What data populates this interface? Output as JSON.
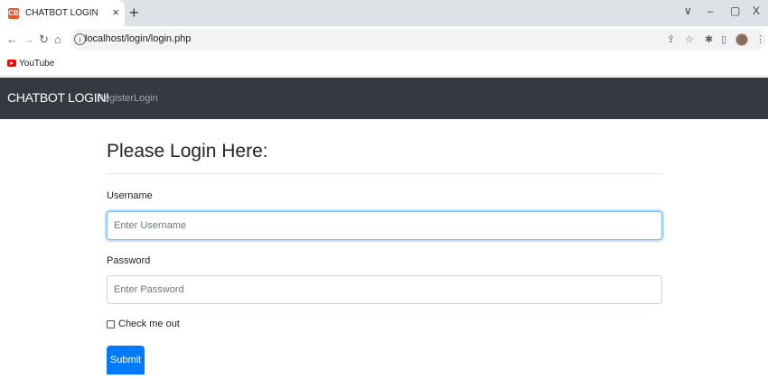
{
  "browser": {
    "tab_title": "CHATBOT LOGIN",
    "favicon_text": "CB",
    "new_tab_icon": "+",
    "url": "localhost/login/login.php",
    "bookmark_label": "YouTube",
    "window_controls": [
      "∨",
      "–",
      "▢",
      "X"
    ]
  },
  "navbar": {
    "brand": "CHATBOT LOGIN!",
    "links": [
      "Register",
      "Login"
    ]
  },
  "form": {
    "heading": "Please Login Here:",
    "username_label": "Username",
    "username_placeholder": "Enter Username",
    "username_value": "",
    "password_label": "Password",
    "password_placeholder": "Enter Password",
    "password_value": "",
    "checkbox_label": "Check me out",
    "checkbox_checked": false,
    "submit_label": "Submit"
  },
  "colors": {
    "navbar_bg": "#343a40",
    "primary": "#007bff",
    "focus_border": "#80bdff"
  }
}
